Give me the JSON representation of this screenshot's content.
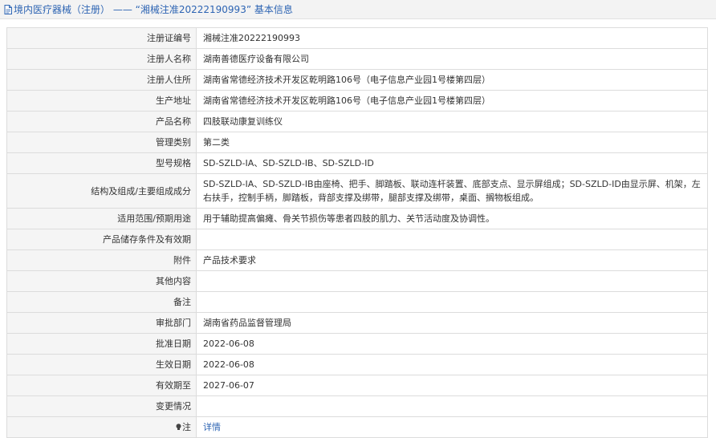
{
  "header": {
    "title": "境内医疗器械（注册） —— “湘械注准20222190993” 基本信息",
    "icon": "document-icon"
  },
  "rows": [
    {
      "label": "注册证编号",
      "value": "湘械注准20222190993"
    },
    {
      "label": "注册人名称",
      "value": "湖南善德医疗设备有限公司"
    },
    {
      "label": "注册人住所",
      "value": "湖南省常德经济技术开发区乾明路106号（电子信息产业园1号楼第四层）"
    },
    {
      "label": "生产地址",
      "value": "湖南省常德经济技术开发区乾明路106号（电子信息产业园1号楼第四层）"
    },
    {
      "label": "产品名称",
      "value": "四肢联动康复训练仪"
    },
    {
      "label": "管理类别",
      "value": "第二类"
    },
    {
      "label": "型号规格",
      "value": "SD-SZLD-IA、SD-SZLD-IB、SD-SZLD-ID"
    },
    {
      "label": "结构及组成/主要组成成分",
      "value": "SD-SZLD-IA、SD-SZLD-IB由座椅、把手、脚踏板、联动连杆装置、底部支点、显示屏组成；SD-SZLD-ID由显示屏、机架，左右扶手，控制手柄，脚踏板，背部支撑及绑带，腿部支撑及绑带，桌面、搁物板组成。"
    },
    {
      "label": "适用范围/预期用途",
      "value": "用于辅助提高偏瘫、骨关节损伤等患者四肢的肌力、关节活动度及协调性。"
    },
    {
      "label": "产品储存条件及有效期",
      "value": ""
    },
    {
      "label": "附件",
      "value": "产品技术要求"
    },
    {
      "label": "其他内容",
      "value": ""
    },
    {
      "label": "备注",
      "value": ""
    },
    {
      "label": "审批部门",
      "value": "湖南省药品监督管理局"
    },
    {
      "label": "批准日期",
      "value": "2022-06-08"
    },
    {
      "label": "生效日期",
      "value": "2022-06-08"
    },
    {
      "label": "有效期至",
      "value": "2027-06-07"
    },
    {
      "label": "变更情况",
      "value": ""
    }
  ],
  "note_row": {
    "label": "注",
    "icon": "lightbulb-icon",
    "link_text": "详情"
  },
  "colors": {
    "accent": "#2d64b3",
    "label_bg": "#f5f5f5",
    "border": "#dcdcdc",
    "header_bg": "#f3f3f3"
  }
}
